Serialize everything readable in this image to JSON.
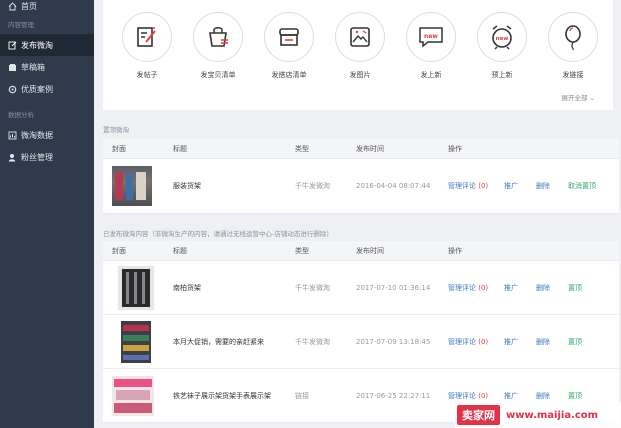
{
  "sidebar": {
    "home": "首页",
    "section_content": "内容管理",
    "items_content": [
      "发布微淘",
      "草稿箱",
      "优质案例"
    ],
    "section_data": "数据分析",
    "items_data": [
      "微淘数据",
      "粉丝管理"
    ]
  },
  "actions": [
    {
      "label": "发帖子",
      "icon": "post-icon"
    },
    {
      "label": "发宝贝清单",
      "icon": "bag-icon"
    },
    {
      "label": "发搭店清单",
      "icon": "shop-icon"
    },
    {
      "label": "发图片",
      "icon": "image-icon"
    },
    {
      "label": "发上新",
      "icon": "new-icon"
    },
    {
      "label": "预上新",
      "icon": "alarm-new-icon"
    },
    {
      "label": "发链接",
      "icon": "balloon-icon"
    }
  ],
  "expand_label": "展开全部",
  "pinned": {
    "section_title": "置顶微淘",
    "headers": {
      "cover": "封面",
      "title": "标题",
      "type": "类型",
      "time": "发布时间",
      "ops": "操作"
    },
    "rows": [
      {
        "title": "服装货架",
        "type": "千牛发微淘",
        "time": "2016-04-04 08:07:44",
        "comment": "管理评论",
        "count": "(0)",
        "promote": "推广",
        "delete": "删除",
        "pin": "取消置顶"
      }
    ]
  },
  "published": {
    "section_title": "已发布微淘内容（非微淘生产的内容，请通过无线运营中心-店铺动态进行删除）",
    "headers": {
      "cover": "封面",
      "title": "标题",
      "type": "类型",
      "time": "发布时间",
      "ops": "操作"
    },
    "rows": [
      {
        "title": "南柏货架",
        "type": "千牛发微淘",
        "time": "2017-07-10 01:36:14",
        "comment": "管理评论",
        "count": "(0)",
        "promote": "推广",
        "delete": "删除",
        "pin": "置顶"
      },
      {
        "title": "本月大促销，需要的亲赶紧来",
        "type": "千牛发微淘",
        "time": "2017-07-09 13:18:45",
        "comment": "管理评论",
        "count": "(0)",
        "promote": "推广",
        "delete": "删除",
        "pin": "置顶"
      },
      {
        "title": "铁艺袜子展示架货架手表展示架",
        "type": "链接",
        "time": "2017-06-25 22:27:11",
        "comment": "管理评论",
        "count": "(0)",
        "promote": "推广",
        "delete": "删除",
        "pin": "置顶"
      }
    ]
  },
  "watermark": {
    "logo": "卖家网",
    "url": "www.maijia.com"
  },
  "colors": {
    "sidebar": "#2f3b4a",
    "link": "#3a78c2",
    "green": "#2fae6b",
    "red": "#e04040",
    "brand": "#e2324a"
  }
}
